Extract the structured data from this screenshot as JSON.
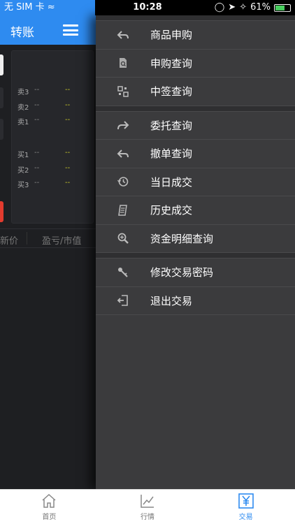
{
  "status_bar": {
    "carrier": "无 SIM 卡",
    "time": "10:28",
    "battery": "61%"
  },
  "left_panel": {
    "title": "转账",
    "menu_icon": "hamburger-icon",
    "sell_rows": [
      {
        "label": "卖3",
        "price": "--",
        "volume": "--"
      },
      {
        "label": "卖2",
        "price": "--",
        "volume": "--"
      },
      {
        "label": "卖1",
        "price": "--",
        "volume": "--"
      }
    ],
    "buy_rows": [
      {
        "label": "买1",
        "price": "--",
        "volume": "--"
      },
      {
        "label": "买2",
        "price": "--",
        "volume": "--"
      },
      {
        "label": "买3",
        "price": "--",
        "volume": "--"
      }
    ],
    "col_price": "新价",
    "col_pnl": "盈亏/市值"
  },
  "drawer": {
    "group1": [
      {
        "label": "商品申购",
        "icon": "reply-arrow-icon"
      },
      {
        "label": "申购查询",
        "icon": "document-search-icon"
      },
      {
        "label": "中签查询",
        "icon": "qrcode-icon"
      }
    ],
    "group2": [
      {
        "label": "委托查询",
        "icon": "forward-arrow-icon"
      },
      {
        "label": "撤单查询",
        "icon": "undo-arrow-icon"
      },
      {
        "label": "当日成交",
        "icon": "history-clock-icon"
      },
      {
        "label": "历史成交",
        "icon": "receipt-icon"
      },
      {
        "label": "资金明细查询",
        "icon": "zoom-in-icon"
      }
    ],
    "group3": [
      {
        "label": "修改交易密码",
        "icon": "key-icon"
      },
      {
        "label": "退出交易",
        "icon": "logout-icon"
      }
    ]
  },
  "bottom_nav": {
    "tabs": [
      {
        "label": "首页",
        "icon": "home-icon"
      },
      {
        "label": "行情",
        "icon": "chart-icon"
      },
      {
        "label": "交易",
        "icon": "yen-icon"
      }
    ],
    "active_index": 2
  },
  "colors": {
    "accent": "#2e8bf0",
    "drawer_bg": "#3b3b3d",
    "quote_volume": "#c9c92a"
  }
}
